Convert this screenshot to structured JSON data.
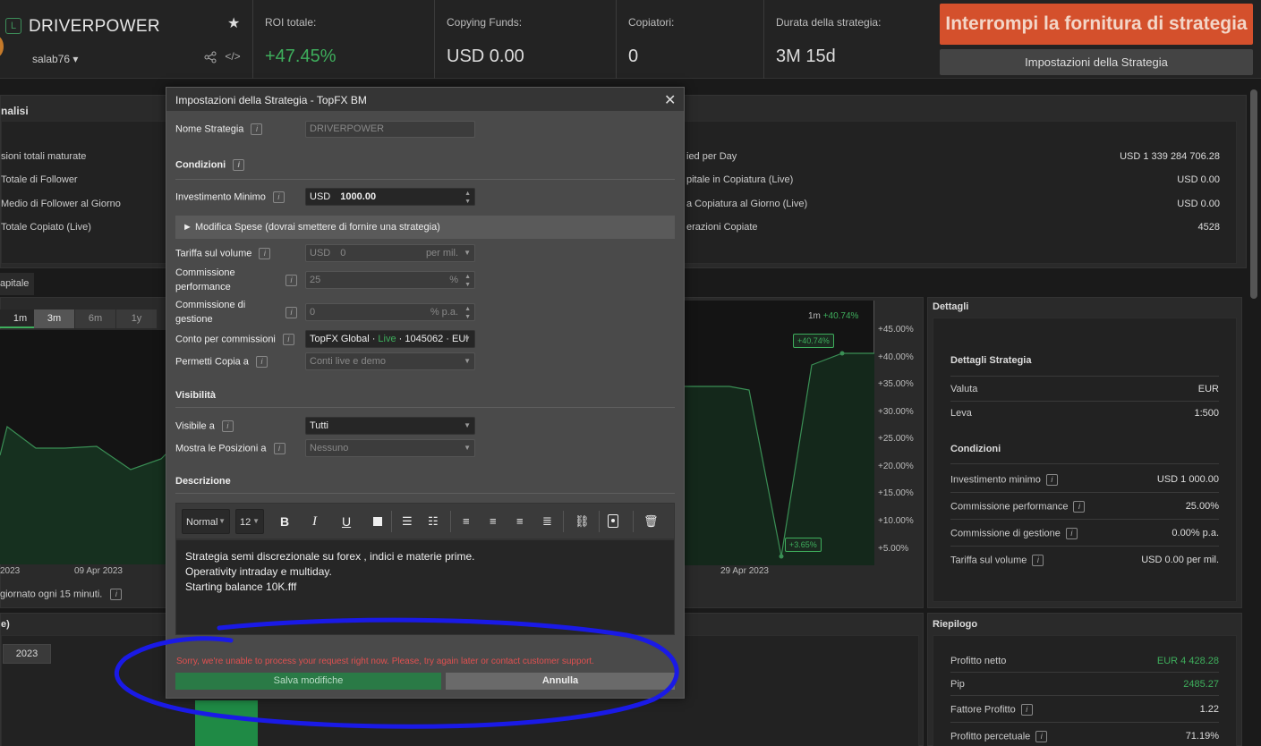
{
  "header": {
    "logo_badge": "L",
    "strategy_name": "DRIVERPOWER",
    "owner": "salab76 ▾",
    "stats": [
      {
        "label": "ROI totale:",
        "value": "+47.45%"
      },
      {
        "label": "Copying Funds:",
        "value": "USD 0.00"
      },
      {
        "label": "Copiatori:",
        "value": "0"
      },
      {
        "label": "Durata della strategia:",
        "value": "3M 15d"
      }
    ],
    "stop_button": "Interrompi la fornitura di strategia",
    "settings_button": "Impostazioni della Strategia"
  },
  "bg": {
    "analysis_title": "nalisi",
    "analysis_left": [
      "sioni totali maturate",
      "Totale di Follower",
      "Medio di Follower al Giorno",
      "Totale Copiato (Live)"
    ],
    "analysis_right": [
      {
        "label": "ied per Day",
        "value": "USD 1 339 284 706.28"
      },
      {
        "label": "pitale in Copiatura (Live)",
        "value": "USD 0.00"
      },
      {
        "label": "a Copiatura al Giorno (Live)",
        "value": "USD 0.00"
      },
      {
        "label": "erazioni Copiate",
        "value": "4528"
      }
    ],
    "capital_tab": "apitale",
    "periods": [
      "1m",
      "3m",
      "6m",
      "1y"
    ],
    "chart_dates_left": [
      "2023",
      "09 Apr 2023"
    ],
    "chart_date_right": "29 Apr 2023",
    "chart_legend": "1m",
    "chart_legend_value": "+40.74%",
    "update_note": "giornato ogni 15 minuti.",
    "section_e": "e)",
    "year_button": "2023"
  },
  "chart_data": {
    "type": "area",
    "ylabels": [
      "+45.00%",
      "+40.00%",
      "+35.00%",
      "+30.00%",
      "+25.00%",
      "+20.00%",
      "+15.00%",
      "+10.00%",
      "+5.00%"
    ],
    "annotations": [
      "+40.74%",
      "+3.65%"
    ]
  },
  "details": {
    "title": "Dettagli",
    "strategy_details": "Dettagli Strategia",
    "rows1": [
      {
        "label": "Valuta",
        "value": "EUR"
      },
      {
        "label": "Leva",
        "value": "1:500"
      }
    ],
    "conditions": "Condizioni",
    "rows2": [
      {
        "label": "Investimento minimo",
        "value": "USD 1 000.00"
      },
      {
        "label": "Commissione performance",
        "value": "25.00%"
      },
      {
        "label": "Commissione di gestione",
        "value": "0.00% p.a."
      },
      {
        "label": "Tariffa sul volume",
        "value": "USD 0.00 per mil."
      }
    ]
  },
  "summary": {
    "title": "Riepilogo",
    "rows": [
      {
        "label": "Profitto netto",
        "value": "EUR 4 428.28"
      },
      {
        "label": "Pip",
        "value": "2485.27"
      },
      {
        "label": "Fattore Profitto",
        "value": "1.22"
      },
      {
        "label": "Profitto percetuale",
        "value": "71.19%"
      }
    ]
  },
  "modal": {
    "title": "Impostazioni della Strategia - TopFX BM",
    "name_label": "Nome Strategia",
    "name_value": "DRIVERPOWER",
    "conditions": "Condizioni",
    "min_invest_label": "Investimento Minimo",
    "min_invest_currency": "USD",
    "min_invest_value": "1000.00",
    "fees_toggle": "► Modifica Spese (dovrai smettere di fornire una strategia)",
    "volume_label": "Tariffa sul volume",
    "volume_currency": "USD",
    "volume_value": "0",
    "volume_unit": "per mil.",
    "perf_label": "Commissione performance",
    "perf_value": "25",
    "perf_unit": "%",
    "mgmt_label": "Commissione di gestione",
    "mgmt_value": "0",
    "mgmt_unit": "% p.a.",
    "account_label": "Conto per commissioni",
    "account_name": "TopFX Global · ",
    "account_live": "Live",
    "account_rest": " · 1045062 · EUI",
    "copy_label": "Permetti Copia a",
    "copy_value": "Conti live e demo",
    "visibility": "Visibilità",
    "visible_label": "Visibile a",
    "visible_value": "Tutti",
    "positions_label": "Mostra le Posizioni a",
    "positions_value": "Nessuno",
    "description": "Descrizione",
    "toolbar_format": "Normal",
    "toolbar_size": "12",
    "description_lines": [
      "Strategia semi discrezionale su forex , indici e materie prime.",
      "Operativity intraday e multiday.",
      "Starting balance 10K.fff"
    ],
    "error": "Sorry, we're unable to process your request right now. Please, try again later or contact customer support.",
    "save": "Salva modifiche",
    "cancel": "Annulla"
  }
}
